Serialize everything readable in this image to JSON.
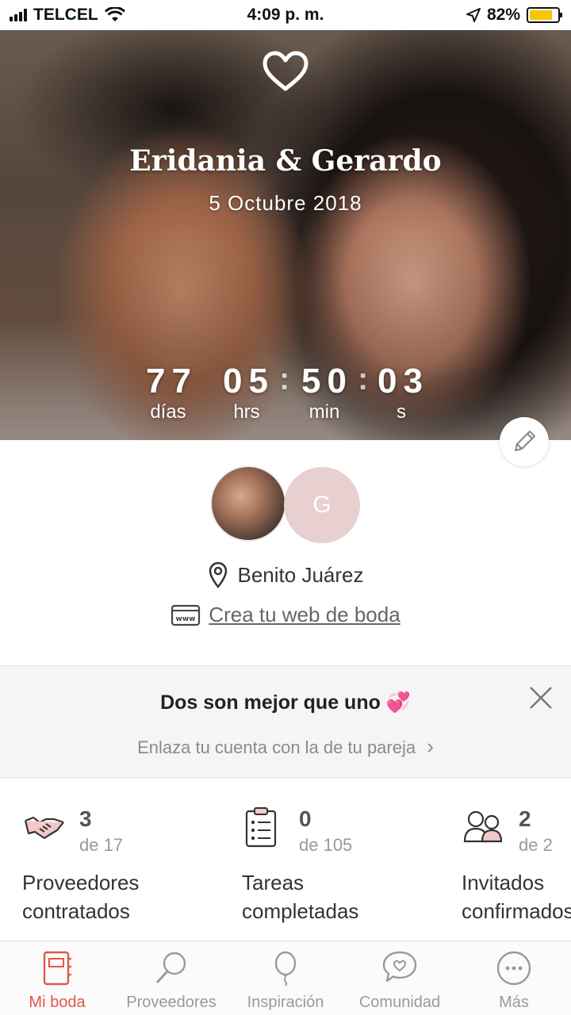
{
  "status_bar": {
    "carrier": "TELCEL",
    "time": "4:09 p. m.",
    "battery_percent": "82%",
    "battery_level": 0.82,
    "battery_color": "#f6c700"
  },
  "hero": {
    "icon": "heart-outline-icon",
    "names": "Eridania & Gerardo",
    "date": "5 Octubre 2018",
    "countdown": {
      "days": "77",
      "hours": "05",
      "minutes": "50",
      "seconds": "03",
      "separator": ":",
      "days_label": "días",
      "hours_label": "hrs",
      "minutes_label": "min",
      "seconds_label": "s"
    },
    "edit_icon": "pencil-icon"
  },
  "couple": {
    "partner_initial": "G",
    "location": "Benito Juárez",
    "web_link": "Crea tu web de boda"
  },
  "partner_banner": {
    "title": "Dos son mejor que uno 💞",
    "subtitle": "Enlaza tu cuenta con la de tu pareja",
    "chevron": "›"
  },
  "stats": [
    {
      "icon": "handshake-icon",
      "value": "3",
      "total": "de 17",
      "label_line1": "Proveedores",
      "label_line2": "contratados"
    },
    {
      "icon": "checklist-icon",
      "value": "0",
      "total": "de 105",
      "label_line1": "Tareas",
      "label_line2": "completadas"
    },
    {
      "icon": "guests-icon",
      "value": "2",
      "total": "de 2",
      "label_line1": "Invitados",
      "label_line2": "confirmados"
    }
  ],
  "tabbar": {
    "active_color": "#e2574c",
    "items": [
      {
        "label": "Mi boda",
        "icon": "notebook-icon"
      },
      {
        "label": "Proveedores",
        "icon": "search-icon"
      },
      {
        "label": "Inspiración",
        "icon": "balloon-icon"
      },
      {
        "label": "Comunidad",
        "icon": "chat-heart-icon"
      },
      {
        "label": "Más",
        "icon": "more-icon"
      }
    ]
  }
}
